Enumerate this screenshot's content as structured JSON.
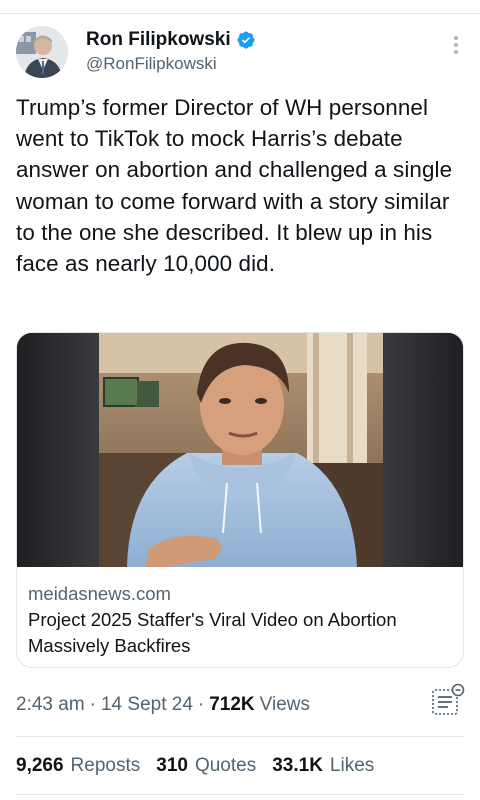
{
  "author": {
    "name": "Ron Filipkowski",
    "handle": "@RonFilipkowski",
    "verified": true
  },
  "tweet": {
    "text": "Trump’s former Director of WH personnel went to TikTok to mock Harris’s debate answer on abortion and challenged a single woman to come forward with a story similar to the one she described. It blew up in his face as nearly 10,000 did."
  },
  "card": {
    "domain": "meidasnews.com",
    "title": "Project 2025 Staffer's Viral Video on Abortion Massively Backfires"
  },
  "meta": {
    "time": "2:43 am",
    "date": "14 Sept 24",
    "views_count": "712K",
    "views_label": "Views"
  },
  "stats": {
    "reposts_count": "9,266",
    "reposts_label": "Reposts",
    "quotes_count": "310",
    "quotes_label": "Quotes",
    "likes_count": "33.1K",
    "likes_label": "Likes"
  },
  "colors": {
    "text": "#0f1419",
    "secondary": "#536471",
    "verified": "#1d9bf0",
    "border": "#e6e8ea"
  },
  "icons": [
    "verified-badge-icon",
    "more-options-icon",
    "view-analytics-icon"
  ]
}
